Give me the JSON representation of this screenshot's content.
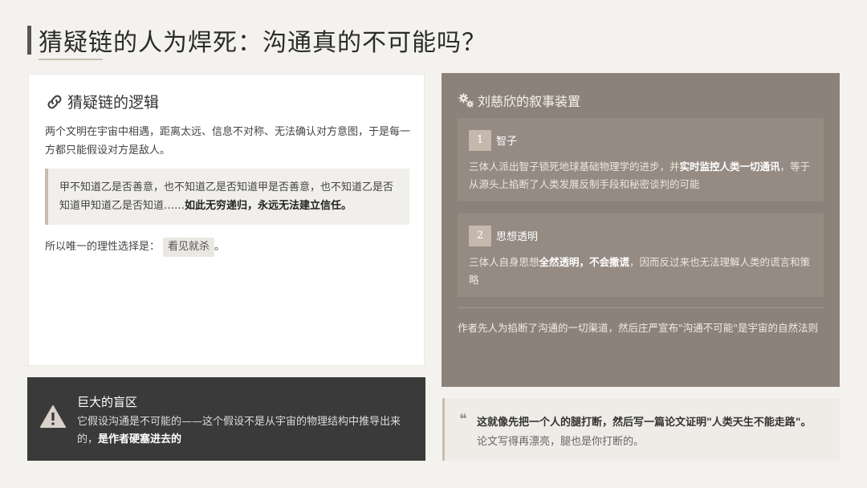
{
  "page": {
    "title": "猜疑链的人为焊死：沟通真的不可能吗？"
  },
  "logic": {
    "heading": "猜疑链的逻辑",
    "icon": "link-icon",
    "paragraph1": "两个文明在宇宙中相遇，距离太远、信息不对称、无法确认对方意图，于是每一方都只能假设对方是敌人。",
    "quote_plain": "甲不知道乙是否善意，也不知道乙是否知道甲是否善意，也不知道乙是否知道甲知道乙是否知道……",
    "quote_bold": "如此无穷递归，永远无法建立信任。",
    "conclusion_prefix": "所以唯一的理性选择是：",
    "conclusion_tag": "看见就杀",
    "conclusion_suffix": "。"
  },
  "blind_zone": {
    "icon": "warning-icon",
    "title": "巨大的盲区",
    "text_plain": "它假设沟通是不可能的——这个假设不是从宇宙的物理结构中推导出来的，",
    "text_bold": "是作者硬塞进去的"
  },
  "device": {
    "icon": "gears-icon",
    "heading": "刘慈欣的叙事装置",
    "items": [
      {
        "num": "1",
        "title": "智子",
        "desc_plain1": "三体人派出智子锁死地球基础物理学的进步，并",
        "desc_bold": "实时监控人类一切通讯",
        "desc_plain2": "，等于从源头上掐断了人类发展反制手段和秘密谈判的可能"
      },
      {
        "num": "2",
        "title": "思想透明",
        "desc_plain1": "三体人自身思想",
        "desc_bold": "全然透明，不会撒谎",
        "desc_plain2": "，因而反过来也无法理解人类的谎言和策略"
      }
    ],
    "footer": "作者先人为掐断了沟通的一切渠道，然后庄严宣布\"沟通不可能\"是宇宙的自然法则"
  },
  "quote": {
    "icon": "quote-icon",
    "line1": "这就像先把一个人的腿打断，然后写一篇论文证明\"人类天生不能走路\"。",
    "line2": "论文写得再漂亮，腿也是你打断的。"
  },
  "colors": {
    "background": "#f4f2ef",
    "device_card": "#8c8279",
    "blind_zone": "#3a3a3a",
    "accent": "#c5b9ac"
  }
}
